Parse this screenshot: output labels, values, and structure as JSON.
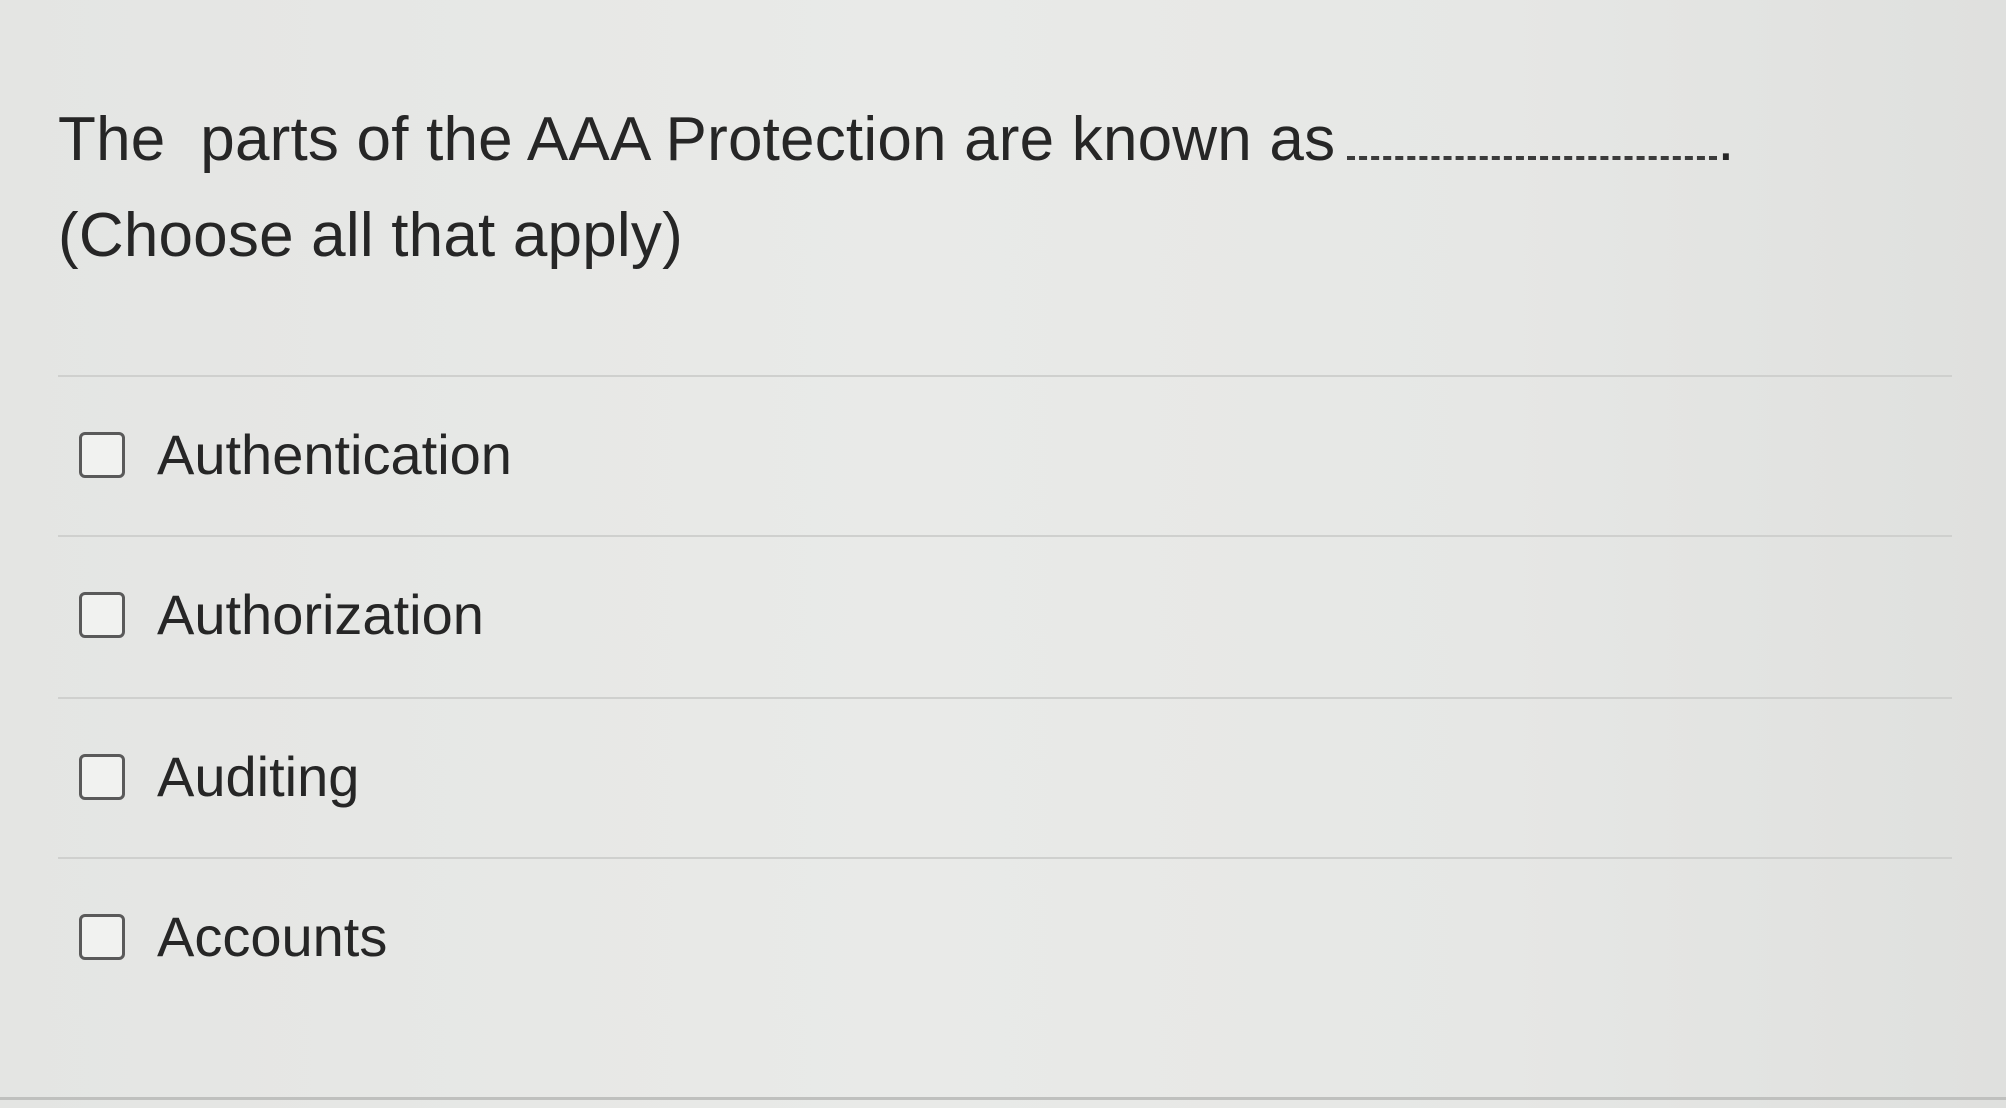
{
  "question": {
    "line1": "The  parts of the AAA Protection are known as",
    "line1_end": ".",
    "line2": "(Choose all that apply)"
  },
  "options": [
    {
      "label": "Authentication",
      "checked": false
    },
    {
      "label": "Authorization",
      "checked": false
    },
    {
      "label": "Auditing",
      "checked": false
    },
    {
      "label": "Accounts",
      "checked": false
    }
  ]
}
